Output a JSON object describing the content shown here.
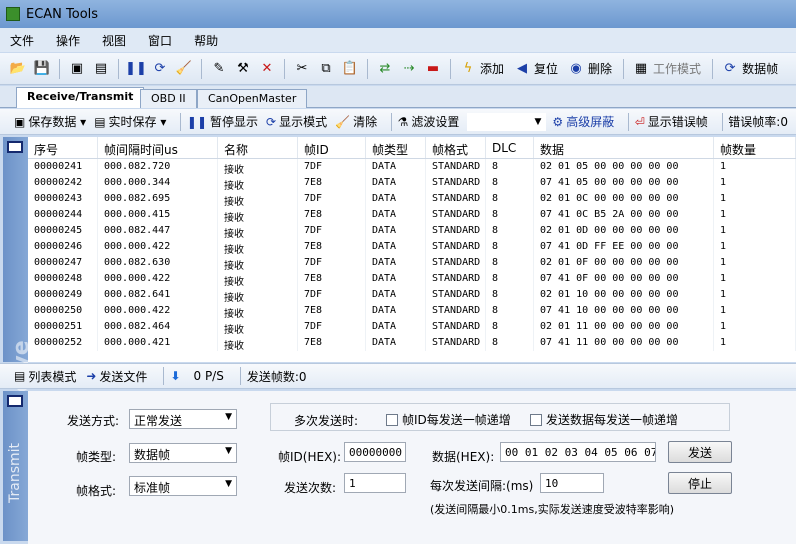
{
  "window": {
    "title": "ECAN Tools"
  },
  "menu": [
    "文件",
    "操作",
    "视图",
    "窗口",
    "帮助"
  ],
  "toolbar": {
    "add": "添加",
    "reset": "复位",
    "delete": "删除",
    "work_mode": "工作模式",
    "data": "数据帧"
  },
  "tabs": [
    "Receive/Transmit",
    "OBD II",
    "CanOpenMaster"
  ],
  "subbar": {
    "save_data": "保存数据",
    "realtime_save": "实时保存",
    "pause_display": "暂停显示",
    "display_mode": "显示模式",
    "clear": "清除",
    "filter_settings": "滤波设置",
    "advanced_mask": "高级屏蔽",
    "show_error_frame": "显示错误帧",
    "error_rate": "错误帧率:0"
  },
  "side": {
    "receive": "Receive",
    "transmit": "Transmit"
  },
  "grid": {
    "columns": [
      "序号",
      "帧间隔时间us",
      "名称",
      "帧ID",
      "帧类型",
      "帧格式",
      "DLC",
      "数据",
      "帧数量"
    ],
    "rows": [
      [
        "00000241",
        "000.082.720",
        "接收",
        "7DF",
        "DATA",
        "STANDARD",
        "8",
        "02 01 05 00 00 00 00 00",
        "1"
      ],
      [
        "00000242",
        "000.000.344",
        "接收",
        "7E8",
        "DATA",
        "STANDARD",
        "8",
        "07 41 05 00 00 00 00 00",
        "1"
      ],
      [
        "00000243",
        "000.082.695",
        "接收",
        "7DF",
        "DATA",
        "STANDARD",
        "8",
        "02 01 0C 00 00 00 00 00",
        "1"
      ],
      [
        "00000244",
        "000.000.415",
        "接收",
        "7E8",
        "DATA",
        "STANDARD",
        "8",
        "07 41 0C B5 2A 00 00 00",
        "1"
      ],
      [
        "00000245",
        "000.082.447",
        "接收",
        "7DF",
        "DATA",
        "STANDARD",
        "8",
        "02 01 0D 00 00 00 00 00",
        "1"
      ],
      [
        "00000246",
        "000.000.422",
        "接收",
        "7E8",
        "DATA",
        "STANDARD",
        "8",
        "07 41 0D FF EE 00 00 00",
        "1"
      ],
      [
        "00000247",
        "000.082.630",
        "接收",
        "7DF",
        "DATA",
        "STANDARD",
        "8",
        "02 01 0F 00 00 00 00 00",
        "1"
      ],
      [
        "00000248",
        "000.000.422",
        "接收",
        "7E8",
        "DATA",
        "STANDARD",
        "8",
        "07 41 0F 00 00 00 00 00",
        "1"
      ],
      [
        "00000249",
        "000.082.641",
        "接收",
        "7DF",
        "DATA",
        "STANDARD",
        "8",
        "02 01 10 00 00 00 00 00",
        "1"
      ],
      [
        "00000250",
        "000.000.422",
        "接收",
        "7E8",
        "DATA",
        "STANDARD",
        "8",
        "07 41 10 00 00 00 00 00",
        "1"
      ],
      [
        "00000251",
        "000.082.464",
        "接收",
        "7DF",
        "DATA",
        "STANDARD",
        "8",
        "02 01 11 00 00 00 00 00",
        "1"
      ],
      [
        "00000252",
        "000.000.421",
        "接收",
        "7E8",
        "DATA",
        "STANDARD",
        "8",
        "07 41 11 00 00 00 00 00",
        "1"
      ]
    ]
  },
  "listbar": {
    "list_mode": "列表模式",
    "send_file": "发送文件",
    "rate": "0 P/S",
    "sent_count": "发送帧数:0"
  },
  "transmit": {
    "send_mode_label": "发送方式:",
    "send_mode_value": "正常发送",
    "frame_type_label": "帧类型:",
    "frame_type_value": "数据帧",
    "frame_format_label": "帧格式:",
    "frame_format_value": "标准帧",
    "multi_send_label": "多次发送时:",
    "chk_id_inc": "帧ID每发送一帧递增",
    "chk_data_inc": "发送数据每发送一帧递增",
    "frame_id_label": "帧ID(HEX):",
    "frame_id_value": "00000000",
    "data_label": "数据(HEX):",
    "data_value": "00 01 02 03 04 05 06 07",
    "send_count_label": "发送次数:",
    "send_count_value": "1",
    "interval_label": "每次发送间隔:(ms)",
    "interval_value": "10",
    "send_button": "发送",
    "stop_button": "停止",
    "note": "(发送间隔最小0.1ms,实际发送速度受波特率影响)"
  },
  "colors": {
    "title_bar": "#6c98cf",
    "side_panel": "#7a9fd0",
    "accent_blue": "#1c3fa8"
  }
}
